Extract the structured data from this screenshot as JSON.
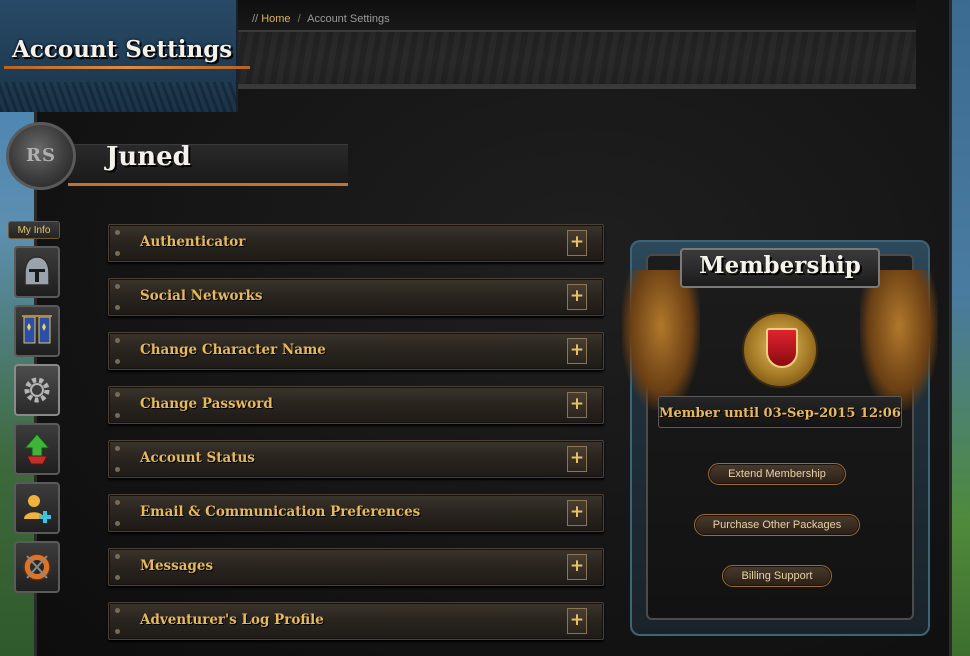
{
  "breadcrumb": {
    "prefix": "//",
    "home": "Home",
    "separator": "/",
    "current": "Account Settings"
  },
  "header": {
    "title": "Account Settings",
    "logo_text": "RS"
  },
  "user": {
    "name": "Juned"
  },
  "sidebar": {
    "tab_label": "My Info",
    "items": [
      {
        "icon": "helmet-icon"
      },
      {
        "icon": "banners-icon"
      },
      {
        "icon": "gear-icon"
      },
      {
        "icon": "level-up-icon"
      },
      {
        "icon": "add-friend-icon"
      },
      {
        "icon": "shield-emblem-icon"
      }
    ]
  },
  "settings": {
    "sections": [
      {
        "label": "Authenticator",
        "toggle": "+"
      },
      {
        "label": "Social Networks",
        "toggle": "+"
      },
      {
        "label": "Change Character Name",
        "toggle": "+"
      },
      {
        "label": "Change Password",
        "toggle": "+"
      },
      {
        "label": "Account Status",
        "toggle": "+"
      },
      {
        "label": "Email & Communication Preferences",
        "toggle": "+"
      },
      {
        "label": "Messages",
        "toggle": "+"
      },
      {
        "label": "Adventurer's Log Profile",
        "toggle": "+"
      }
    ]
  },
  "membership": {
    "title": "Membership",
    "status": "Member until 03-Sep-2015 12:06",
    "buttons": {
      "extend": "Extend Membership",
      "purchase": "Purchase Other Packages",
      "billing": "Billing Support"
    }
  },
  "colors": {
    "gold_text": "#e8b95c",
    "accent_orange": "#c8702e",
    "title_blue": "#294a66"
  }
}
